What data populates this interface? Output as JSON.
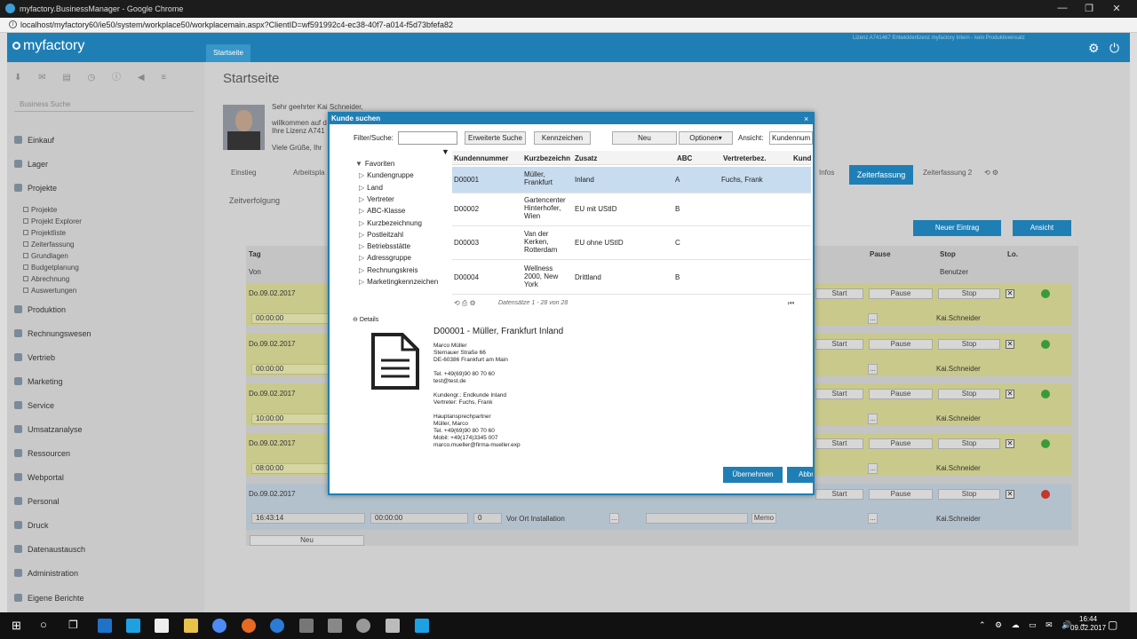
{
  "browser": {
    "window_title": "myfactory.BusinessManager - Google Chrome",
    "url": "localhost/myfactory60/ie50/system/workplace50/workplacemain.aspx?ClientID=wf591992c4-ec38-40f7-a014-f5d73bfefa82",
    "controls": {
      "minimize": "—",
      "maximize": "❐",
      "close": "✕"
    }
  },
  "app": {
    "logo": "myfactory",
    "tab": "Startseite",
    "licence": "Lizenz A741467 Entwicklerlizenz myfactory Intern - kein Produktiveinsatz",
    "accent": "#1f7fb5"
  },
  "sidebar": {
    "toolbar_icons": "⬇ ✉ ▤ ◷ ⓘ ◀ ≡",
    "search_placeholder": "Business Suche",
    "modules": [
      "Einkauf",
      "Lager",
      "Projekte",
      "Produktion",
      "Rechnungswesen",
      "Vertrieb",
      "Marketing",
      "Service",
      "Umsatzanalyse",
      "Ressourcen",
      "Webportal",
      "Personal",
      "Druck",
      "Datenaustausch",
      "Administration",
      "Eigene Berichte"
    ],
    "project_sub": [
      "Projekte",
      "Projekt Explorer",
      "Projektliste",
      "Zeiterfassung",
      "Grundlagen",
      "Budgetplanung",
      "Abrechnung",
      "Auswertungen"
    ]
  },
  "main": {
    "title": "Startseite",
    "welcome": [
      "Sehr geehrter Kai Schneider,",
      "willkommen auf d",
      "Ihre Lizenz A741",
      "Viele Grüße, Ihr"
    ],
    "tabs": [
      "Einstieg",
      "Arbeitspla",
      "Infos",
      "Zeiterfassung",
      "Zeiterfassung 2"
    ],
    "section": "Zeitverfolgung",
    "new_entry": "Neuer Eintrag",
    "view": "Ansicht",
    "col_tag": "Tag",
    "col_von": "Von",
    "col_pause": "Pause",
    "col_stop": "Stop",
    "col_lo": "Lo.",
    "col_benutzer": "Benutzer",
    "rows": [
      {
        "date": "Do.09.02.2017",
        "time": "00:00:00",
        "user": "Kai.Schneider",
        "status": "#3a9a3a"
      },
      {
        "date": "Do.09.02.2017",
        "time": "00:00:00",
        "user": "Kai.Schneider",
        "status": "#3a9a3a"
      },
      {
        "date": "Do.09.02.2017",
        "time": "10:00:00",
        "user": "Kai.Schneider",
        "status": "#3a9a3a"
      },
      {
        "date": "Do.09.02.2017",
        "time": "08:00:00",
        "user": "Kai.Schneider",
        "status": "#3a9a3a"
      }
    ],
    "active_row": {
      "date": "Do.09.02.2017",
      "start": "16:43:14",
      "elapsed": "00:00:00",
      "count": "0",
      "activity": "Vor Ort Installation",
      "memo": "Memo",
      "user": "Kai.Schneider",
      "status": "#c0392b"
    },
    "btn_start": "Start",
    "btn_pause": "Pause",
    "btn_stop": "Stop",
    "btn_neu": "Neu",
    "dots": "..."
  },
  "dialog": {
    "title": "Kunde suchen",
    "close": "×",
    "filter_label": "Filter/Suche:",
    "filter_value": "",
    "erw_suche": "Erweiterte Suche",
    "kennzeichen": "Kennzeichen",
    "neu": "Neu",
    "optionen": "Optionen▾",
    "ansicht_label": "Ansicht:",
    "ansicht_value": "Kundennum",
    "tree": [
      "Favoriten",
      "Kundengruppe",
      "Land",
      "Vertreter",
      "ABC-Klasse",
      "Kurzbezeichnung",
      "Postleitzahl",
      "Betriebsstätte",
      "Adressgruppe",
      "Rechnungskreis",
      "Marketingkennzeichen"
    ],
    "columns": [
      "Kundennummer",
      "Kurzbezeichn",
      "Zusatz",
      "ABC",
      "Vertreterbez.",
      "Kund"
    ],
    "rows": [
      {
        "nr": "D00001",
        "kurz": "Müller, Frankfurt",
        "zusatz": "Inland",
        "abc": "A",
        "vertreter": "Fuchs, Frank"
      },
      {
        "nr": "D00002",
        "kurz": "Gartencenter Hinterhofer, Wien",
        "zusatz": "EU mit UStID",
        "abc": "B",
        "vertreter": ""
      },
      {
        "nr": "D00003",
        "kurz": "Van der Kerken, Rotterdam",
        "zusatz": "EU ohne UStID",
        "abc": "C",
        "vertreter": ""
      },
      {
        "nr": "D00004",
        "kurz": "Wellness 2000, New York",
        "zusatz": "Drittland",
        "abc": "B",
        "vertreter": ""
      }
    ],
    "record_count": "Datensätze 1 - 28 von 28",
    "details_label": "Details",
    "detail_title": "D00001 - Müller, Frankfurt Inland",
    "detail_address": [
      "Marco Müller",
      "Sternauer Straße 66",
      "DE-60386 Frankfurt am Main"
    ],
    "detail_contact": [
      "Tel. +49(69)90 80 70 60",
      "test@test.de"
    ],
    "detail_group": [
      "Kundengr.: Endkunde Inland",
      "Vertreter: Fuchs, Frank"
    ],
    "detail_partner": [
      "Hauptansprechpartner",
      "Müller, Marco",
      "Tel. +49(69)90 80 70 60",
      "Mobil: +49(174)3345 007",
      "marco.mueller@firma-mueller.exp"
    ],
    "btn_ok": "Übernehmen",
    "btn_cancel": "Abbrechen"
  },
  "taskbar": {
    "time": "16:44",
    "date": "09.02.2017"
  }
}
